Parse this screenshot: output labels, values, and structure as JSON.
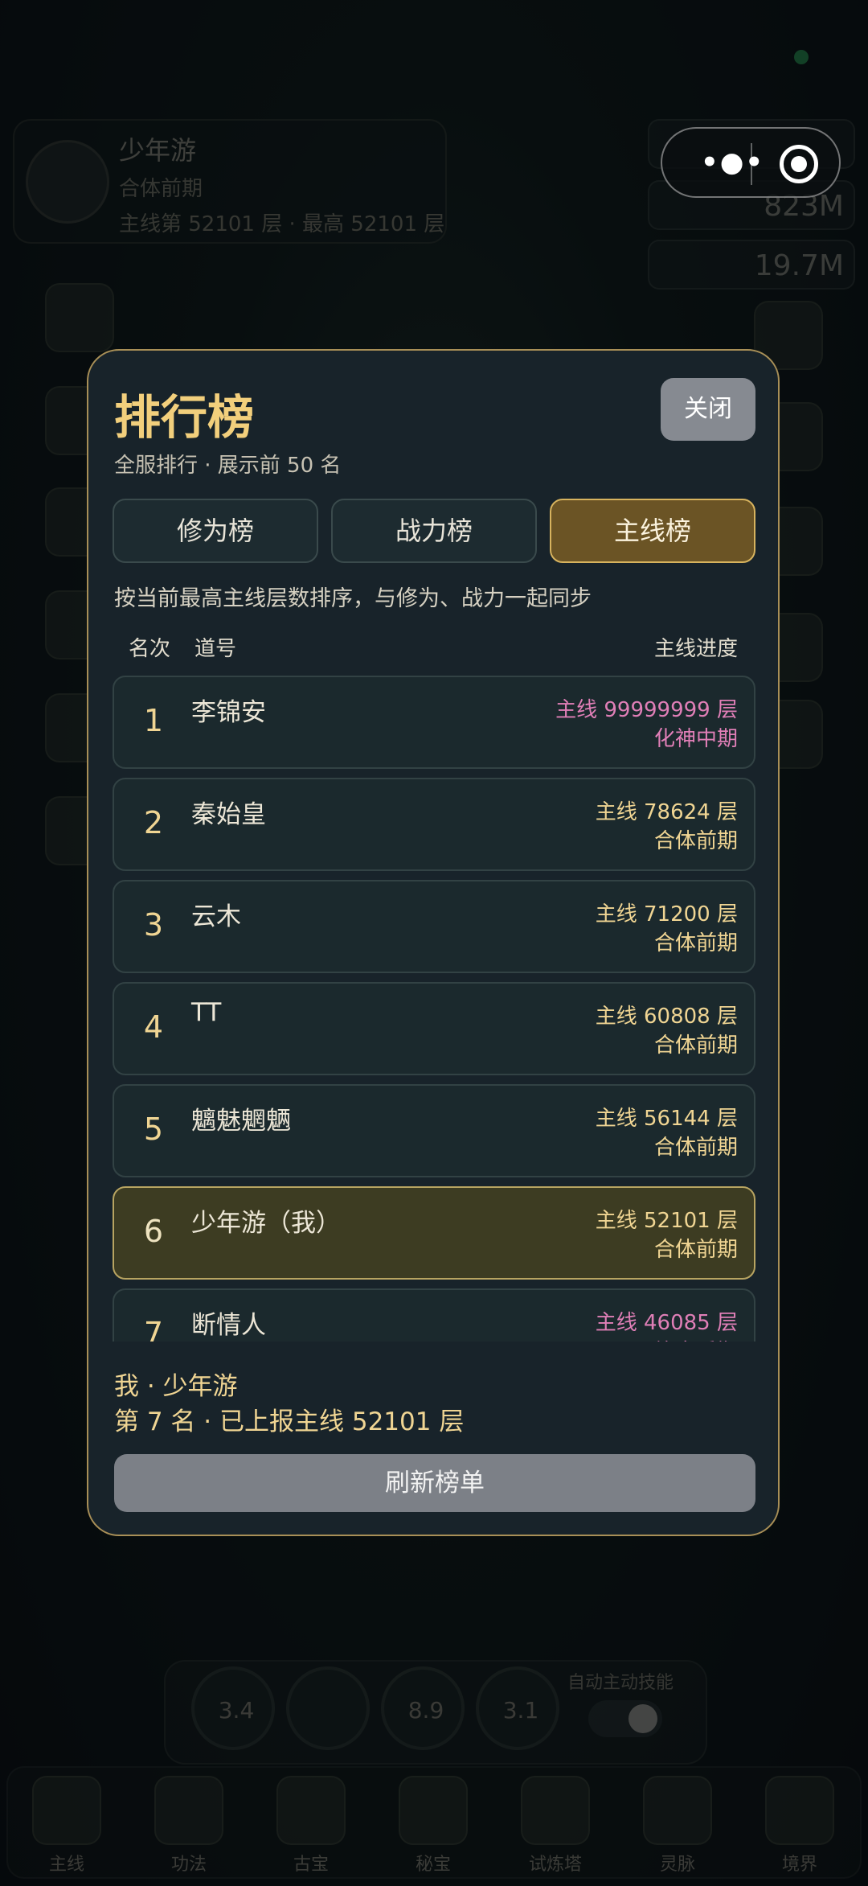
{
  "background": {
    "player": {
      "name": "少年游",
      "realm": "合体前期",
      "floor_text": "主线第 52101 层 · 最高 52101 层"
    },
    "resources": [
      "823M",
      "19.7M"
    ],
    "skills": [
      "3.4",
      "8.9",
      "3.1"
    ],
    "auto_skill_label": "自动主动技能",
    "nav": [
      "主线",
      "功法",
      "古宝",
      "秘宝",
      "试炼塔",
      "灵脉",
      "境界"
    ]
  },
  "modal": {
    "title": "排行榜",
    "subtitle": "全服排行 · 展示前 50 名",
    "close_label": "关闭",
    "tabs": [
      {
        "label": "修为榜",
        "active": false
      },
      {
        "label": "战力榜",
        "active": false
      },
      {
        "label": "主线榜",
        "active": true
      }
    ],
    "description": "按当前最高主线层数排序，与修为、战力一起同步",
    "columns": {
      "rank": "名次",
      "name": "道号",
      "progress": "主线进度"
    },
    "rows": [
      {
        "rank": "1",
        "name": "李锦安",
        "floor": "主线 99999999 层",
        "realm": "化神中期",
        "highlight": "pink"
      },
      {
        "rank": "2",
        "name": "秦始皇",
        "floor": "主线 78624 层",
        "realm": "合体前期"
      },
      {
        "rank": "3",
        "name": "云木",
        "floor": "主线 71200 层",
        "realm": "合体前期"
      },
      {
        "rank": "4",
        "name": " TT",
        "floor": "主线 60808 层",
        "realm": "合体前期"
      },
      {
        "rank": "5",
        "name": "魑魅魍魉",
        "floor": "主线 56144 层",
        "realm": "合体前期"
      },
      {
        "rank": "6",
        "name": "少年游（我）",
        "floor": "主线 52101 层",
        "realm": "合体前期",
        "is_me": true
      },
      {
        "rank": "7",
        "name": "断情人",
        "floor": "主线 46085 层",
        "realm": "炼虚后期",
        "highlight": "pink"
      }
    ],
    "footer": {
      "me_label": "我 · 少年游",
      "rank_text": "第 7 名 · 已上报主线 52101 层"
    },
    "refresh_label": "刷新榜单"
  },
  "colors": {
    "accent_gold": "#f2cf7c",
    "pink_highlight": "#e07fb7",
    "active_tab": "#6b5425",
    "modal_border": "#a88f57"
  }
}
